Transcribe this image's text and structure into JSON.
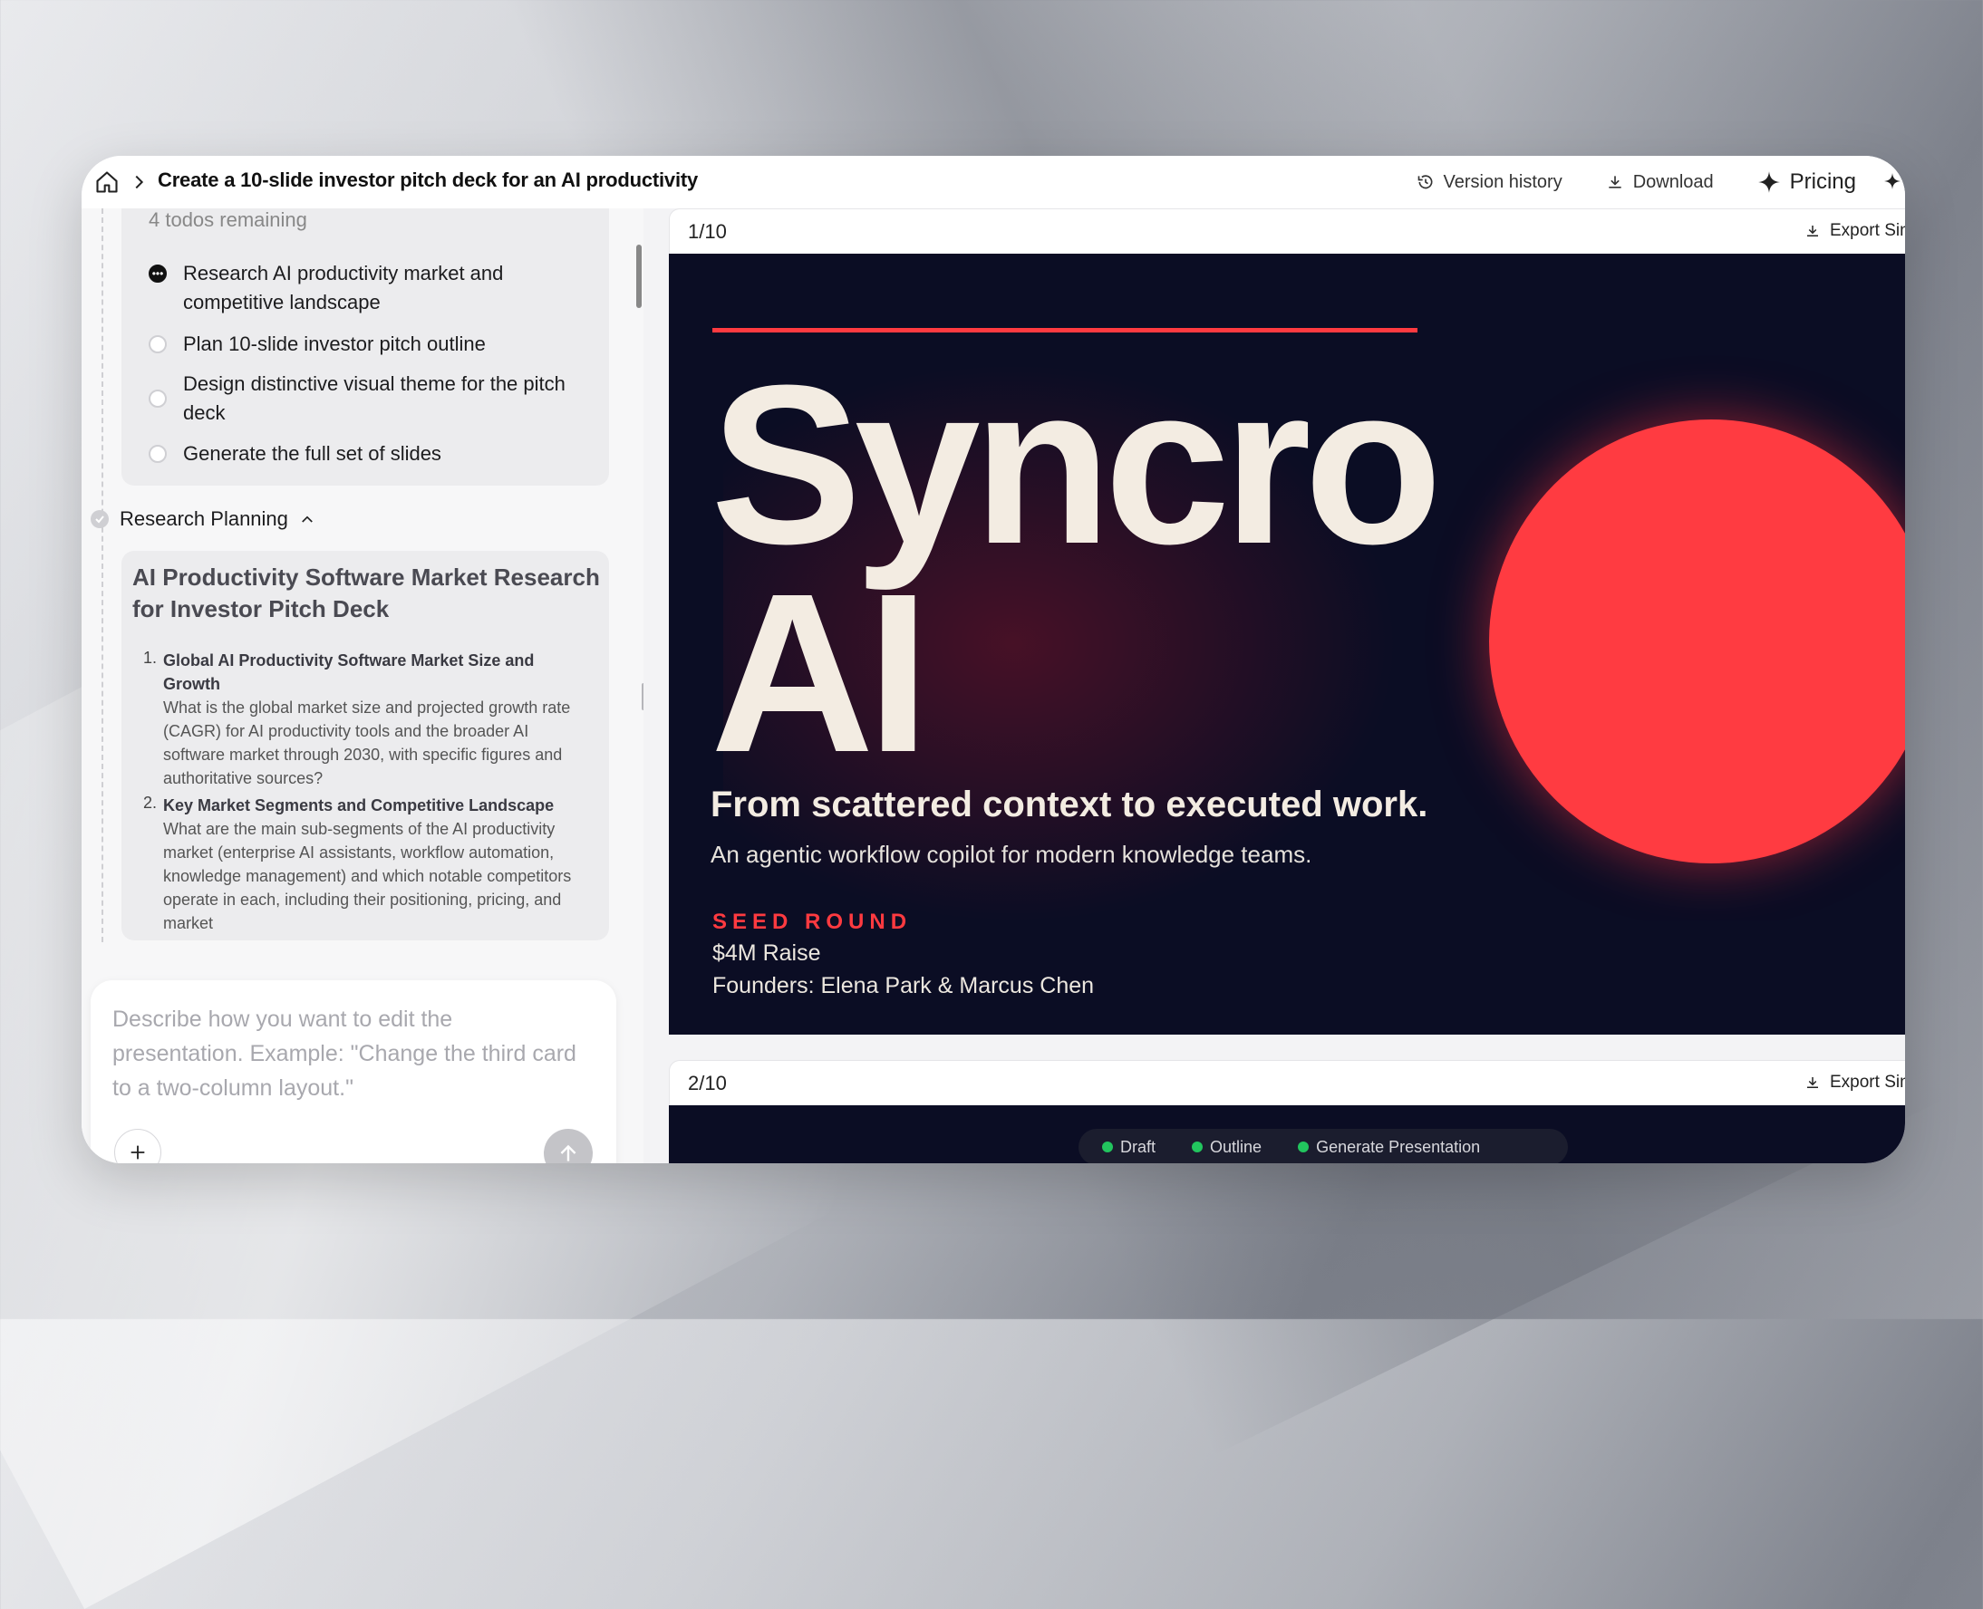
{
  "header": {
    "title": "Create a 10-slide investor pitch deck for an AI productivity",
    "actions": {
      "version_history": "Version history",
      "download": "Download",
      "pricing": "Pricing"
    }
  },
  "todos": {
    "remaining": "4 todos remaining",
    "items": [
      {
        "label": "Research AI productivity market and competitive landscape",
        "status": "in-progress"
      },
      {
        "label": "Plan 10-slide investor pitch outline",
        "status": "pending"
      },
      {
        "label": "Design distinctive visual theme for the pitch deck",
        "status": "pending"
      },
      {
        "label": "Generate the full set of slides",
        "status": "pending"
      }
    ]
  },
  "research": {
    "section_label": "Research Planning",
    "title": "AI Productivity Software Market Research for Investor Pitch Deck",
    "questions": [
      {
        "num": "1.",
        "heading": "Global AI Productivity Software Market Size and Growth",
        "detail": "What is the global market size and projected growth rate (CAGR) for AI productivity tools and the broader AI software market through 2030, with specific figures and authoritative sources?"
      },
      {
        "num": "2.",
        "heading": "Key Market Segments and Competitive Landscape",
        "detail": "What are the main sub-segments of the AI productivity market (enterprise AI assistants, workflow automation, knowledge management) and which notable competitors operate in each, including their positioning, pricing, and market"
      }
    ]
  },
  "composer": {
    "placeholder": "Describe how you want to edit the presentation. Example: \"Change the third card to a two-column layout.\""
  },
  "slides": [
    {
      "counter": "1/10",
      "export_label": "Export Sin",
      "title_line1": "Syncro",
      "title_line2": "AI",
      "tagline": "From scattered context to executed work.",
      "subtagline": "An agentic workflow copilot for modern knowledge teams.",
      "round_label": "SEED ROUND",
      "raise": "$4M Raise",
      "founders": "Founders: Elena Park & Marcus Chen",
      "colors": {
        "background": "#0b0d24",
        "accent": "#ff3a40",
        "text": "#f3ece2"
      }
    },
    {
      "counter": "2/10",
      "export_label": "Export Sin"
    }
  ],
  "progress": {
    "steps": [
      "Draft",
      "Outline",
      "Generate Presentation"
    ],
    "color": "#22c55e"
  }
}
